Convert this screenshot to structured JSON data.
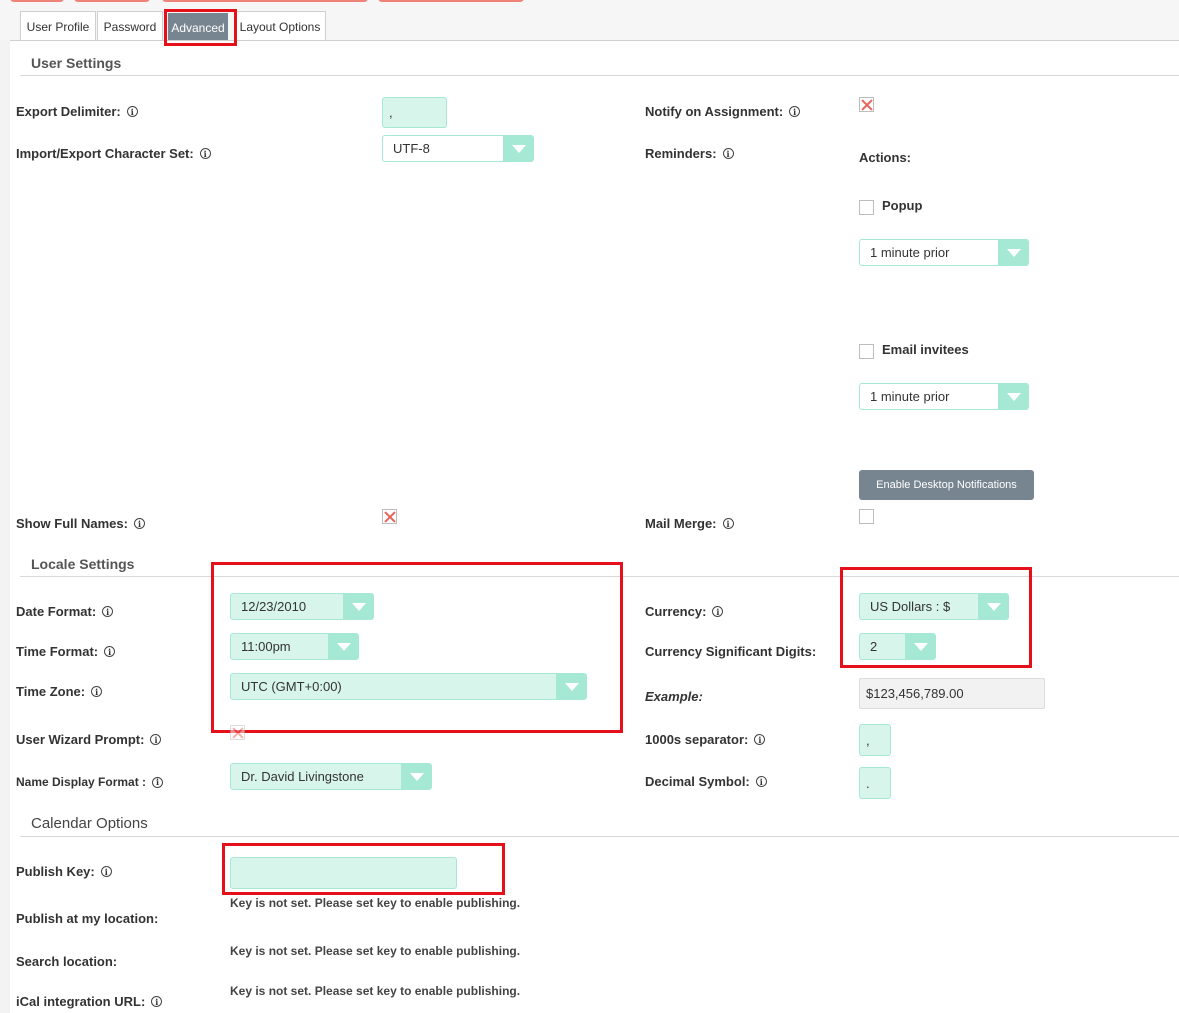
{
  "tabs": [
    {
      "label": "User Profile"
    },
    {
      "label": "Password"
    },
    {
      "label": "Advanced"
    },
    {
      "label": "Layout Options"
    }
  ],
  "user_settings": {
    "title": "User Settings",
    "export_delimiter": {
      "label": "Export Delimiter:",
      "value": ","
    },
    "charset": {
      "label": "Import/Export Character Set:",
      "value": "UTF-8"
    },
    "notify_on_assignment": {
      "label": "Notify on Assignment:",
      "checked": true
    },
    "reminders": {
      "label": "Reminders:",
      "actions_label": "Actions:",
      "popup_label": "Popup",
      "popup_time": "1 minute prior",
      "email_label": "Email invitees",
      "email_time": "1 minute prior",
      "desktop_button": "Enable Desktop Notifications"
    },
    "show_full_names": {
      "label": "Show Full Names:",
      "checked": true
    },
    "mail_merge": {
      "label": "Mail Merge:",
      "checked": false
    }
  },
  "locale_settings": {
    "title": "Locale Settings",
    "date_format": {
      "label": "Date Format:",
      "value": "12/23/2010"
    },
    "time_format": {
      "label": "Time Format:",
      "value": "11:00pm"
    },
    "time_zone": {
      "label": "Time Zone:",
      "value": "UTC (GMT+0:00)"
    },
    "user_wizard_prompt": {
      "label": "User Wizard Prompt:",
      "checked": true
    },
    "name_display_format": {
      "label": "Name Display Format :",
      "value": "Dr. David Livingstone"
    },
    "currency": {
      "label": "Currency:",
      "value": "US Dollars : $"
    },
    "currency_digits": {
      "label": "Currency Significant Digits:",
      "value": "2"
    },
    "example": {
      "label": "Example:",
      "value": "$123,456,789.00"
    },
    "thousands_separator": {
      "label": "1000s separator:",
      "value": ","
    },
    "decimal_symbol": {
      "label": "Decimal Symbol:",
      "value": "."
    }
  },
  "calendar_options": {
    "title": "Calendar Options",
    "publish_key": {
      "label": "Publish Key:",
      "value": ""
    },
    "publish_key_note": "Key is not set. Please set key to enable publishing.",
    "publish_location": {
      "label": "Publish at my location:",
      "note": "Key is not set. Please set key to enable publishing."
    },
    "search_location": {
      "label": "Search location:",
      "note": "Key is not set. Please set key to enable publishing."
    },
    "ical_url": {
      "label": "iCal integration URL:"
    }
  },
  "colors": {
    "accent_fill": "#d8f5ec",
    "accent_border": "#a5e8d3",
    "active_tab": "#778591",
    "highlight": "#e5101a",
    "checkbox_x": "#e8635a"
  }
}
